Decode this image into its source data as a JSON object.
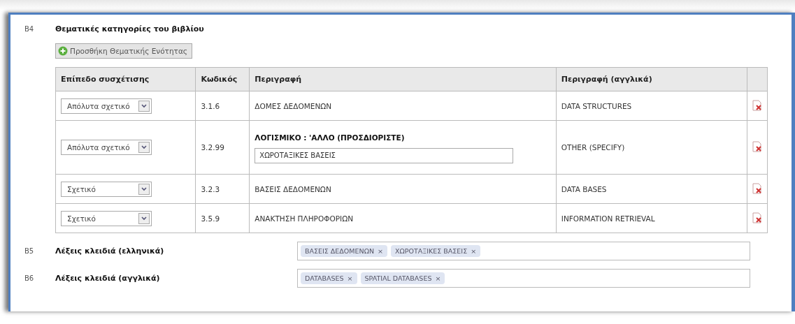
{
  "sections": [
    {
      "code": "B4",
      "title": "Θεματικές κατηγορίες του βιβλίου",
      "add_button": "Προσθήκη Θεματικής Ενότητας",
      "table": {
        "columns": [
          "Επίπεδο συσχέτισης",
          "Κωδικός",
          "Περιγραφή",
          "Περιγραφή (αγγλικά)"
        ],
        "rows": [
          {
            "relevance": "Απόλυτα σχετικό",
            "code": "3.1.6",
            "description": "ΔΟΜΕΣ ΔΕΔΟΜΕΝΩΝ",
            "description_en": "DATA STRUCTURES"
          },
          {
            "relevance": "Απόλυτα σχετικό",
            "code": "3.2.99",
            "description": "ΛΟΓΙΣΜΙΚΟ : 'ΑΛΛΟ (ΠΡΟΣΔΙΟΡΙΣΤΕ)",
            "specify_value": "ΧΩΡΟΤΑΞΙΚΕΣ ΒΑΣΕΙΣ",
            "description_en": "OTHER (SPECIFY)"
          },
          {
            "relevance": "Σχετικό",
            "code": "3.2.3",
            "description": "ΒΑΣΕΙΣ ΔΕΔΟΜΕΝΩΝ",
            "description_en": "DATA BASES"
          },
          {
            "relevance": "Σχετικό",
            "code": "3.5.9",
            "description": "ΑΝΑΚΤΗΣΗ ΠΛΗΡΟΦΟΡΙΩΝ",
            "description_en": "INFORMATION RETRIEVAL"
          }
        ]
      }
    },
    {
      "code": "B5",
      "title": "Λέξεις κλειδιά (ελληνικά)",
      "tags": [
        {
          "label": "ΒΑΣΕΙΣ ΔΕΔΟΜΕΝΩΝ",
          "remove": "×"
        },
        {
          "label": "ΧΩΡΟΤΑΞΙΚΕΣ ΒΑΣΕΙΣ",
          "remove": "×"
        }
      ]
    },
    {
      "code": "B6",
      "title": "Λέξεις κλειδιά (αγγλικά)",
      "tags": [
        {
          "label": "DATABASES",
          "remove": "×"
        },
        {
          "label": "SPATIAL DATABASES",
          "remove": "×"
        }
      ]
    }
  ]
}
